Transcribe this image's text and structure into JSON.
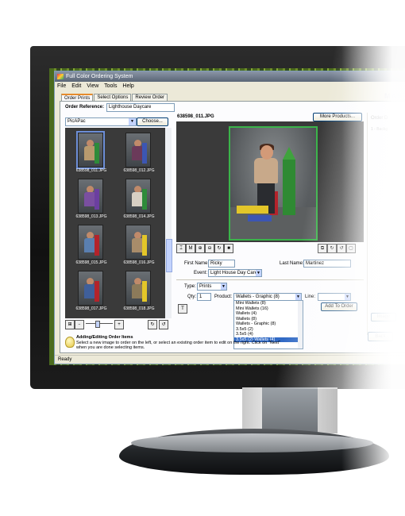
{
  "window": {
    "title": "Full Color Ordering System",
    "brand_corner": "MAS"
  },
  "menu": [
    "File",
    "Edit",
    "View",
    "Tools",
    "Help"
  ],
  "tabs": [
    "Order Prints",
    "Select Options",
    "Review Order"
  ],
  "order_reference": {
    "label": "Order Reference:",
    "value": "Lighthouse Daycare"
  },
  "left": {
    "package_select": "PicAPac",
    "choose_button": "Choose...",
    "thumbnails": [
      {
        "caption": "638598_011.JPG",
        "selected": true
      },
      {
        "caption": "638598_012.JPG"
      },
      {
        "caption": "638598_013.JPG"
      },
      {
        "caption": "638598_014.JPG"
      },
      {
        "caption": "638598_015.JPG"
      },
      {
        "caption": "638598_016.JPG"
      },
      {
        "caption": "638598_017.JPG"
      },
      {
        "caption": "638598_018.JPG"
      }
    ]
  },
  "viewer": {
    "filename": "638598_011.JPG",
    "more_products": "More Products..."
  },
  "subject": {
    "first_name_label": "First Name:",
    "first_name": "Ricky",
    "last_name_label": "Last Name:",
    "last_name": "Martinez",
    "event_label": "Event:",
    "event": "Light House Day Care"
  },
  "order": {
    "type_label": "Type:",
    "type": "Prints",
    "qty_label": "Qty:",
    "qty": "1",
    "product_label": "Product:",
    "product": "Wallets - Graphic (8)",
    "line_label": "Line:",
    "add_button": "Add To Order",
    "product_options": [
      "Mini Wallets (8)",
      "Mini Wallets (16)",
      "Wallets (4)",
      "Wallets (8)",
      "Wallets - Graphic (8)",
      "3.5x5 (2)",
      "3.5x5 (4)",
      "3.5x5 (2) Wallets (4)"
    ],
    "highlighted_option": 7
  },
  "farpane": {
    "header": "Order D",
    "line1": "1 - Backg",
    "image_btn": "Image",
    "back_btn": "Back"
  },
  "info": {
    "title": "Adding/Editing Order Items",
    "desc": "Select a new image to order on the left, or select an existing order item to edit on the right. Click on \"Next\" when you are done selecting items."
  },
  "status": "Ready"
}
